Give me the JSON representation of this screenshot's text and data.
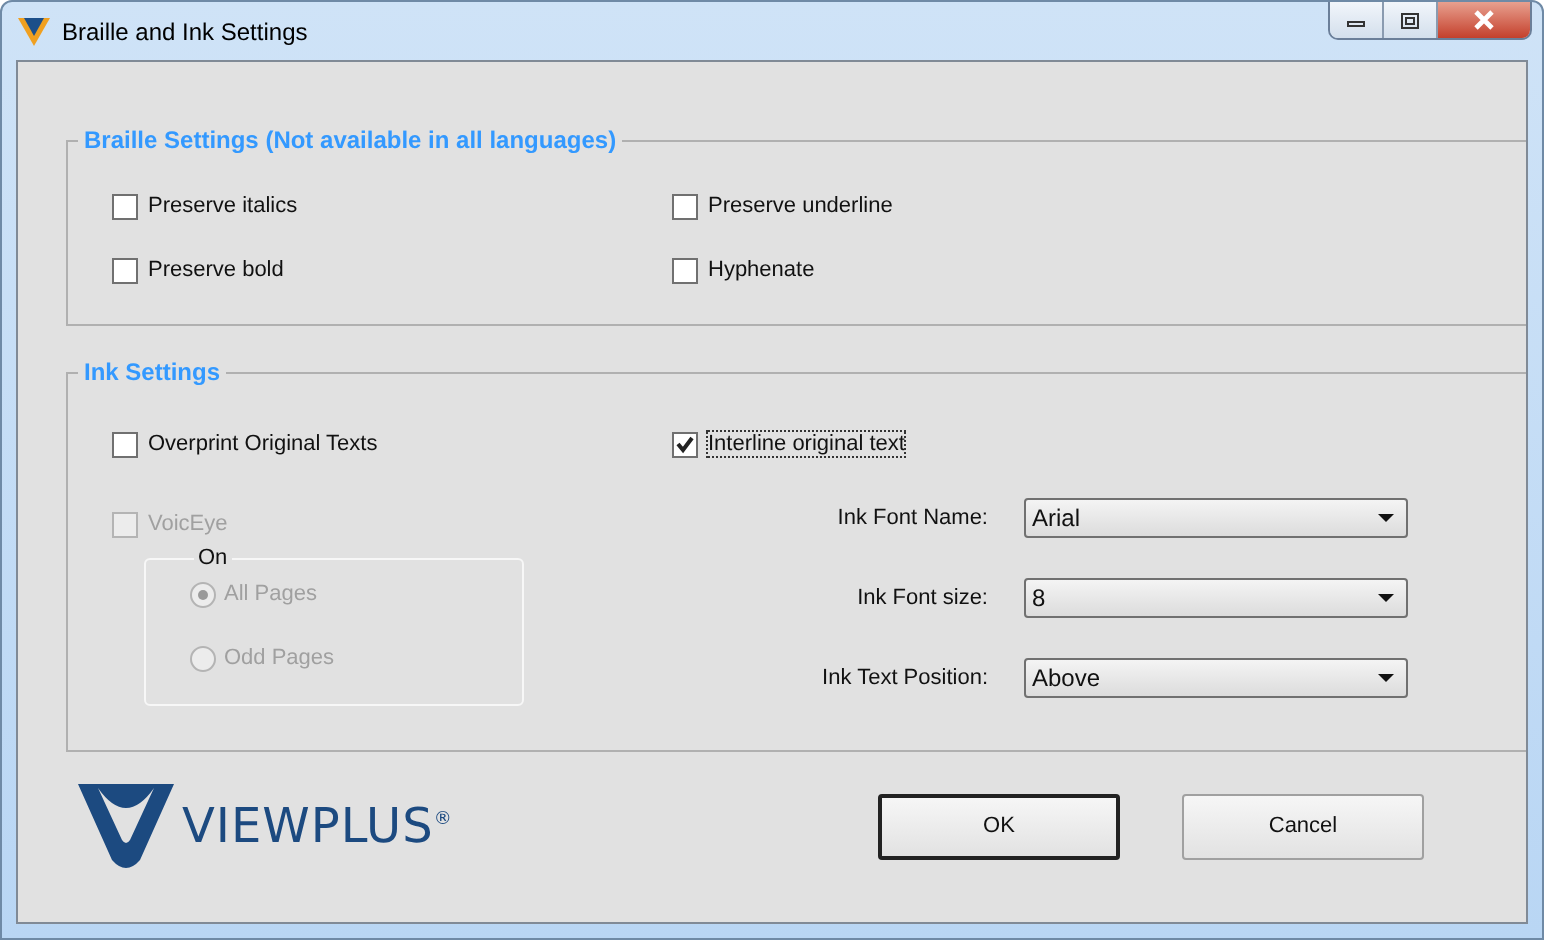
{
  "window": {
    "title": "Braille and Ink Settings"
  },
  "braille_settings": {
    "title": "Braille Settings (Not available in all languages)",
    "options": [
      {
        "label": "Preserve italics",
        "checked": false
      },
      {
        "label": "Preserve underline",
        "checked": false
      },
      {
        "label": "Preserve bold",
        "checked": false
      },
      {
        "label": "Hyphenate",
        "checked": false
      }
    ]
  },
  "ink_settings": {
    "title": "Ink Settings",
    "overprint": {
      "label": "Overprint Original Texts",
      "checked": false
    },
    "interline": {
      "label": "Interline original text",
      "checked": true,
      "focused": true
    },
    "voiceye": {
      "label": "VoicEye",
      "checked": false,
      "disabled": true
    },
    "on_group": {
      "title": "On",
      "options": [
        {
          "label": "All Pages",
          "selected": true,
          "disabled": true
        },
        {
          "label": "Odd Pages",
          "selected": false,
          "disabled": true
        }
      ]
    },
    "fields": [
      {
        "label": "Ink Font Name:",
        "value": "Arial"
      },
      {
        "label": "Ink Font size:",
        "value": "8"
      },
      {
        "label": "Ink Text Position:",
        "value": "Above"
      }
    ]
  },
  "logo": {
    "text": "VIEWPLUS$^{®}$"
  },
  "buttons": [
    {
      "label": "OK",
      "default": true
    },
    {
      "label": "Cancel",
      "default": false
    }
  ]
}
